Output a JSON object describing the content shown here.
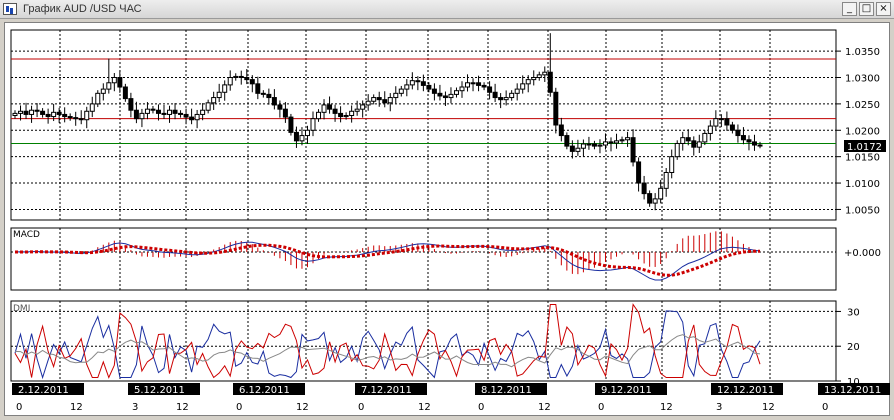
{
  "window": {
    "title": "График AUD /USD  ЧАС",
    "buttons": [
      "_",
      "□",
      "×"
    ]
  },
  "colors": {
    "background": "#ffffff",
    "frame": "#d4d0c8",
    "candle": "#000000",
    "resistance_line": "#c00000",
    "support_line": "#008000",
    "macd_line": "#1a2ea0",
    "signal_line": "#cc0000",
    "dmi_plus": "#1a2ea0",
    "dmi_minus": "#cc0000",
    "adx": "#888888",
    "price_tag_bg": "#000000",
    "date_tag_bg": "#000000"
  },
  "price_panel": {
    "current_price": "1.0172",
    "y_ticks": [
      "1.0350",
      "1.0300",
      "1.0250",
      "1.0200",
      "1.0150",
      "1.0100",
      "1.0050"
    ]
  },
  "macd_panel": {
    "label": "MACD",
    "zero_label": "+0.000"
  },
  "dmi_panel": {
    "label": "DMI",
    "y_ticks": [
      "30",
      "20",
      "10"
    ]
  },
  "time_axis": {
    "dates": [
      "2.12.2011",
      "5.12.2011",
      "6.12.2011",
      "7.12.2011",
      "8.12.2011",
      "9.12.2011",
      "12.12.2011",
      "13.12.2011"
    ],
    "hours": [
      "0",
      "12",
      "3",
      "12",
      "0",
      "12",
      "0",
      "12",
      "0",
      "12",
      "0",
      "12",
      "3",
      "12",
      "0"
    ]
  },
  "chart_data": [
    {
      "type": "candlestick",
      "title": "AUD /USD ЧАС",
      "ylim": [
        1.003,
        1.039
      ],
      "hlines": [
        {
          "value": 1.0335,
          "color": "#c00000"
        },
        {
          "value": 1.0222,
          "color": "#c00000"
        },
        {
          "value": 1.0175,
          "color": "#008000"
        }
      ],
      "closes": [
        1.0232,
        1.0236,
        1.023,
        1.0238,
        1.0236,
        1.023,
        1.0226,
        1.0234,
        1.023,
        1.0226,
        1.0224,
        1.0222,
        1.022,
        1.0236,
        1.025,
        1.027,
        1.0278,
        1.029,
        1.03,
        1.0282,
        1.026,
        1.0238,
        1.0222,
        1.0232,
        1.024,
        1.0238,
        1.0232,
        1.023,
        1.0238,
        1.0232,
        1.023,
        1.0225,
        1.022,
        1.023,
        1.0238,
        1.0252,
        1.0262,
        1.0272,
        1.0286,
        1.03,
        1.0302,
        1.03,
        1.0296,
        1.0288,
        1.027,
        1.0268,
        1.0262,
        1.0248,
        1.024,
        1.0225,
        1.0196,
        1.018,
        1.019,
        1.02,
        1.0222,
        1.0234,
        1.0248,
        1.024,
        1.0232,
        1.0226,
        1.0228,
        1.0236,
        1.024,
        1.0248,
        1.0255,
        1.0262,
        1.0258,
        1.0252,
        1.0262,
        1.027,
        1.0278,
        1.0286,
        1.0294,
        1.0292,
        1.0285,
        1.0278,
        1.027,
        1.0265,
        1.0262,
        1.0268,
        1.0275,
        1.0282,
        1.029,
        1.029,
        1.0285,
        1.0282,
        1.0272,
        1.0262,
        1.0258,
        1.0262,
        1.027,
        1.0278,
        1.0288,
        1.0296,
        1.03,
        1.0305,
        1.031,
        1.0272,
        1.021,
        1.019,
        1.017,
        1.016,
        1.0166,
        1.0174,
        1.0174,
        1.017,
        1.0172,
        1.0178,
        1.0176,
        1.018,
        1.0182,
        1.0186,
        1.014,
        1.01,
        1.008,
        1.0062,
        1.007,
        1.009,
        1.012,
        1.015,
        1.0175,
        1.0186,
        1.018,
        1.0168,
        1.0178,
        1.0194,
        1.0208,
        1.0222,
        1.0222,
        1.021,
        1.02,
        1.019,
        1.0182,
        1.0178,
        1.0172,
        1.0172
      ],
      "highs_max": 1.0384,
      "lows_min": 1.0055
    },
    {
      "type": "line",
      "title": "MACD",
      "series": [
        {
          "name": "MACD",
          "color": "#1a2ea0"
        },
        {
          "name": "Signal",
          "color": "#cc0000"
        }
      ],
      "histogram": true
    },
    {
      "type": "line",
      "title": "DMI",
      "ylim": [
        10,
        33
      ],
      "series": [
        {
          "name": "+DI",
          "color": "#1a2ea0"
        },
        {
          "name": "-DI",
          "color": "#cc0000"
        },
        {
          "name": "ADX",
          "color": "#888888"
        }
      ]
    }
  ]
}
